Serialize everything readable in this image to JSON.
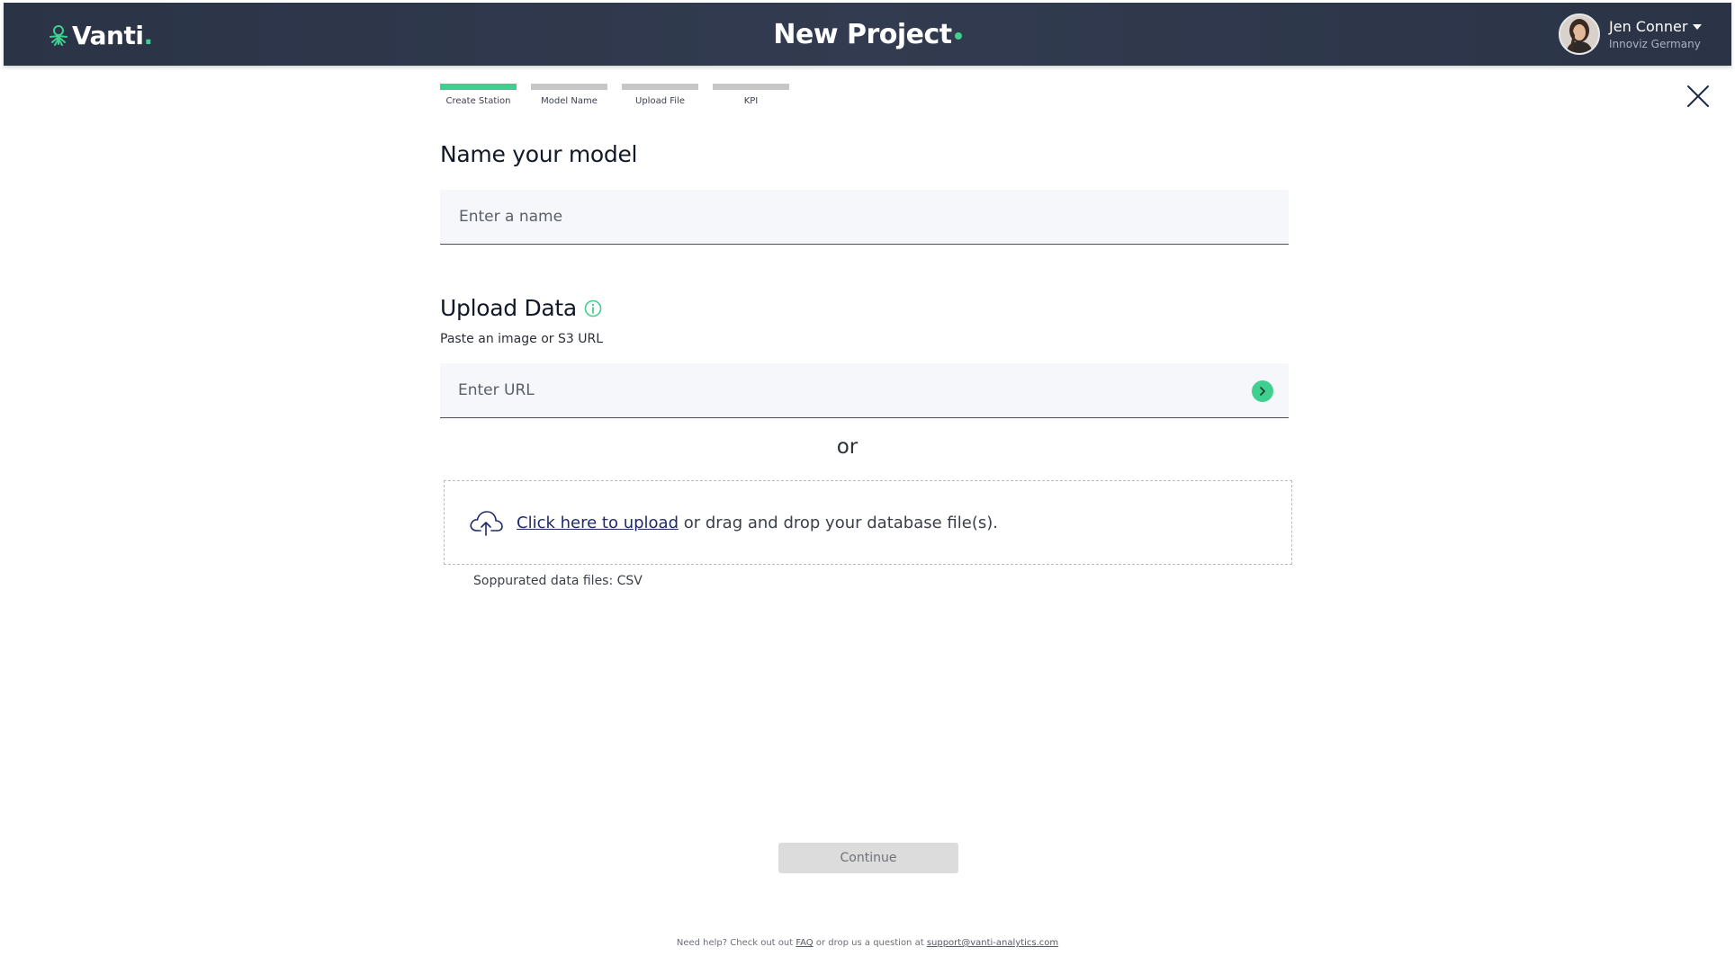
{
  "header": {
    "logo_text": "Vanti",
    "logo_dot": ".",
    "title": "New Project",
    "user": {
      "name": "Jen Conner",
      "organization": "Innoviz Germany"
    }
  },
  "stepper": {
    "steps": [
      {
        "label": "Create Station",
        "active": true
      },
      {
        "label": "Model Name",
        "active": false
      },
      {
        "label": "Upload File",
        "active": false
      },
      {
        "label": "KPI",
        "active": false
      }
    ]
  },
  "name_section": {
    "title": "Name your model",
    "placeholder": "Enter a name",
    "value": ""
  },
  "upload_section": {
    "title": "Upload Data",
    "subtitle": "Paste an image or S3 URL",
    "url_placeholder": "Enter URL",
    "url_value": "",
    "or_label": "or",
    "dropzone_link": "Click here to upload",
    "dropzone_text": " or drag and drop your database file(s).",
    "supported_files": "Soppurated data files: CSV"
  },
  "actions": {
    "continue_label": "Continue"
  },
  "footer": {
    "prefix": "Need help? Check out out ",
    "faq_label": "FAQ",
    "middle": " or drop us a question at ",
    "email": "support@vanti-analytics.com"
  },
  "colors": {
    "header_bg": "#2b3447",
    "accent": "#3fcf8e",
    "link": "#1f2a6e",
    "field_bg": "#f6f7fb",
    "disabled_button": "#dcdcdc"
  },
  "icons": {
    "logo": "vanti-logo-icon",
    "caret": "caret-down-icon",
    "close": "close-icon",
    "info": "info-icon",
    "go": "arrow-right-icon",
    "upload": "cloud-upload-icon"
  }
}
